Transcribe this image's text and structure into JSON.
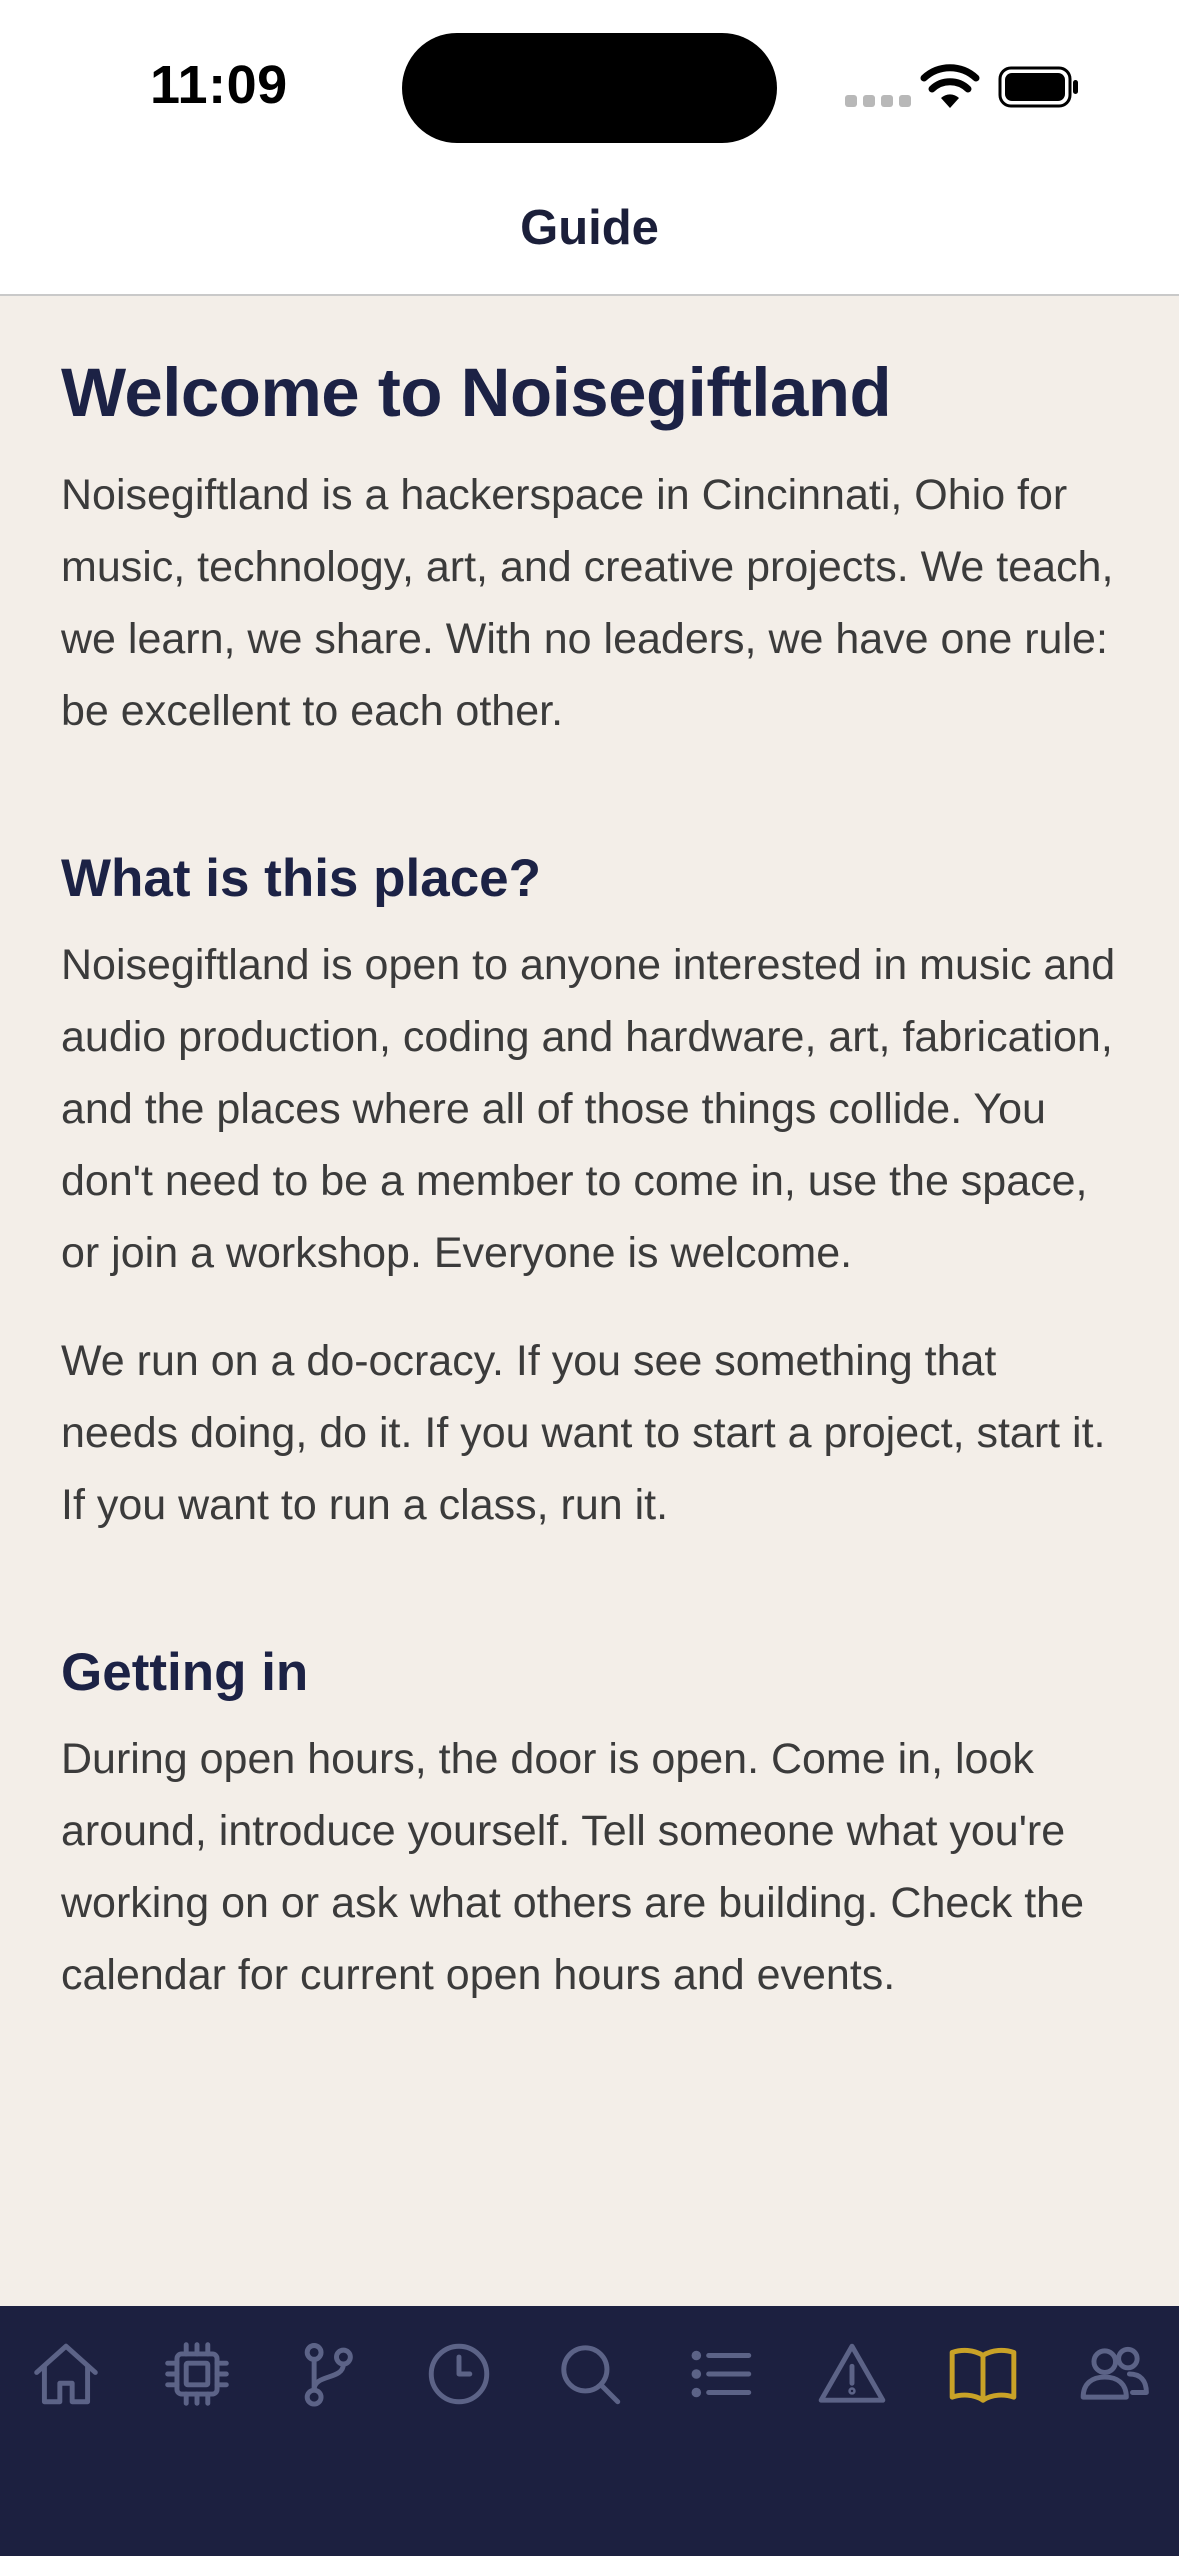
{
  "status_bar": {
    "time": "11:09"
  },
  "nav": {
    "title": "Guide"
  },
  "content": {
    "title": "Welcome to Noisegiftland",
    "intro": "Noisegiftland is a hackerspace in Cincinnati, Ohio for music, technology, art, and creative projects. We teach, we learn, we share. With no leaders, we have one rule: be excellent to each other.",
    "sections": [
      {
        "heading": "What is this place?",
        "paragraphs": [
          "Noisegiftland is open to anyone interested in music and audio production, coding and hardware, art, fabrication, and the places where all of those things collide. You don't need to be a member to come in, use the space, or join a workshop. Everyone is welcome.",
          "We run on a do-ocracy. If you see something that needs doing, do it. If you want to start a project, start it. If you want to run a class, run it."
        ]
      },
      {
        "heading": "Getting in",
        "paragraphs": [
          "During open hours, the door is open. Come in, look around, introduce yourself. Tell someone what you're working on or ask what others are building. Check the calendar for current open hours and events."
        ]
      }
    ]
  },
  "tab_bar": {
    "active_index": 7,
    "active_color": "#c9a227",
    "inactive_color": "#5c6387",
    "background": "#1c2040",
    "items": [
      {
        "icon": "home-icon"
      },
      {
        "icon": "chip-icon"
      },
      {
        "icon": "branch-icon"
      },
      {
        "icon": "clock-icon"
      },
      {
        "icon": "search-icon"
      },
      {
        "icon": "list-icon"
      },
      {
        "icon": "warning-icon"
      },
      {
        "icon": "book-icon"
      },
      {
        "icon": "people-icon"
      }
    ]
  }
}
